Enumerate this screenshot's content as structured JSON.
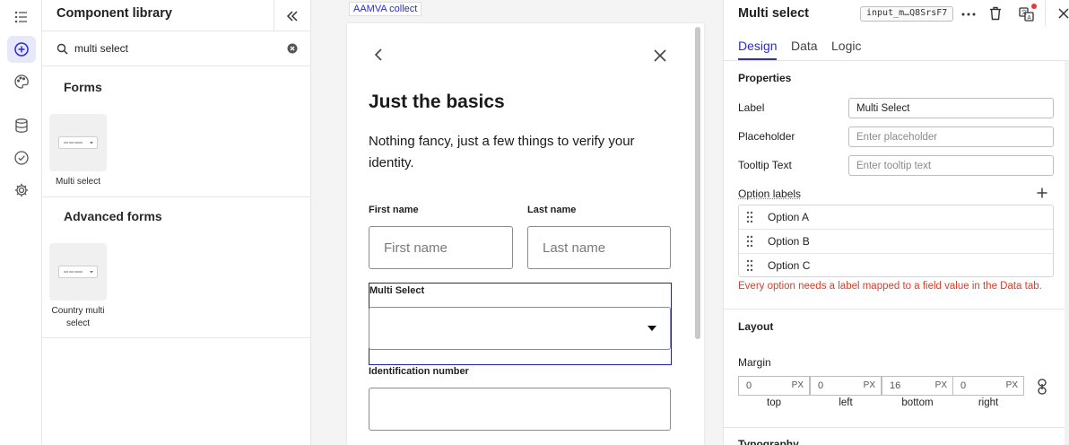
{
  "rail": {
    "items": [
      {
        "icon": "list-icon"
      },
      {
        "icon": "add-circle-icon",
        "active": true
      },
      {
        "icon": "palette-icon"
      },
      {
        "icon": "database-icon"
      },
      {
        "icon": "check-circle-icon"
      },
      {
        "icon": "gear-icon"
      }
    ]
  },
  "library": {
    "title": "Component library",
    "search_value": "multi select",
    "sections": [
      {
        "heading": "Forms",
        "items": [
          {
            "label": "Multi select"
          }
        ]
      },
      {
        "heading": "Advanced forms",
        "items": [
          {
            "label": "Country multi select"
          }
        ]
      }
    ]
  },
  "canvas": {
    "tag": "AAMVA collect",
    "form": {
      "title": "Just the basics",
      "description": "Nothing fancy, just a few things to verify your identity.",
      "first_name": {
        "label": "First name",
        "placeholder": "First name"
      },
      "last_name": {
        "label": "Last name",
        "placeholder": "Last name"
      },
      "multi_select": {
        "label": "Multi Select",
        "value": ""
      },
      "id_number": {
        "label": "Identification number",
        "value": ""
      }
    }
  },
  "props": {
    "title": "Multi select",
    "component_id": "input_m…Q8SrsF7",
    "tabs": [
      {
        "label": "Design"
      },
      {
        "label": "Data"
      },
      {
        "label": "Logic"
      }
    ],
    "active_tab": "Design",
    "properties": {
      "heading": "Properties",
      "label": {
        "name": "Label",
        "value": "Multi Select"
      },
      "placeholder": {
        "name": "Placeholder",
        "placeholder": "Enter placeholder"
      },
      "tooltip": {
        "name": "Tooltip Text",
        "placeholder": "Enter tooltip text"
      },
      "option_labels": {
        "name": "Option labels",
        "options": [
          "Option A",
          "Option B",
          "Option C"
        ],
        "error": "Every option needs a label mapped to a field value in the Data tab."
      }
    },
    "layout": {
      "heading": "Layout",
      "margin_label": "Margin",
      "margins": [
        {
          "value": "0",
          "unit": "PX",
          "caption": "top"
        },
        {
          "value": "0",
          "unit": "PX",
          "caption": "left"
        },
        {
          "value": "16",
          "unit": "PX",
          "caption": "bottom"
        },
        {
          "value": "0",
          "unit": "PX",
          "caption": "right"
        }
      ]
    },
    "next_section": "Typography"
  },
  "colors": {
    "accent": "#2b2bd6",
    "error": "#d9402b",
    "selection_outline": "#2020a8",
    "notification_dot": "#e53935"
  }
}
